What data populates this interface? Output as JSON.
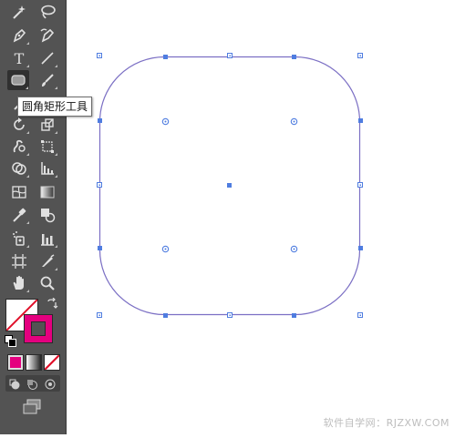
{
  "toolbar": {
    "tools": [
      {
        "name": "magic-wand-tool-icon"
      },
      {
        "name": "lasso-tool-icon"
      },
      {
        "name": "pen-tool-icon"
      },
      {
        "name": "curvature-tool-icon"
      },
      {
        "name": "type-tool-icon",
        "glyph": "T"
      },
      {
        "name": "line-segment-tool-icon"
      },
      {
        "name": "rounded-rectangle-tool-icon",
        "selected": true
      },
      {
        "name": "paintbrush-tool-icon"
      },
      {
        "name": "rotate-tool-icon"
      },
      {
        "name": "scale-tool-icon"
      },
      {
        "name": "warp-tool-icon"
      },
      {
        "name": "free-transform-tool-icon"
      },
      {
        "name": "shape-builder-tool-icon"
      },
      {
        "name": "graph-tool-icon"
      },
      {
        "name": "mesh-tool-icon"
      },
      {
        "name": "gradient-tool-icon"
      },
      {
        "name": "eyedropper-tool-icon"
      },
      {
        "name": "blend-tool-icon"
      },
      {
        "name": "symbol-sprayer-tool-icon"
      },
      {
        "name": "column-graph-tool-icon"
      },
      {
        "name": "artboard-tool-icon"
      },
      {
        "name": "slice-tool-icon"
      },
      {
        "name": "hand-tool-icon"
      },
      {
        "name": "zoom-tool-icon"
      }
    ],
    "fill_color": "#ffffff",
    "stroke_color": "#e4007f",
    "mode_color": "#e4007f"
  },
  "tooltip": {
    "text": "圆角矩形工具"
  },
  "canvas": {
    "path_color": "#7b6fc4",
    "anchor_color": "#4f7de0"
  },
  "watermark": {
    "text": "软件自学网：RJZXW.COM"
  }
}
